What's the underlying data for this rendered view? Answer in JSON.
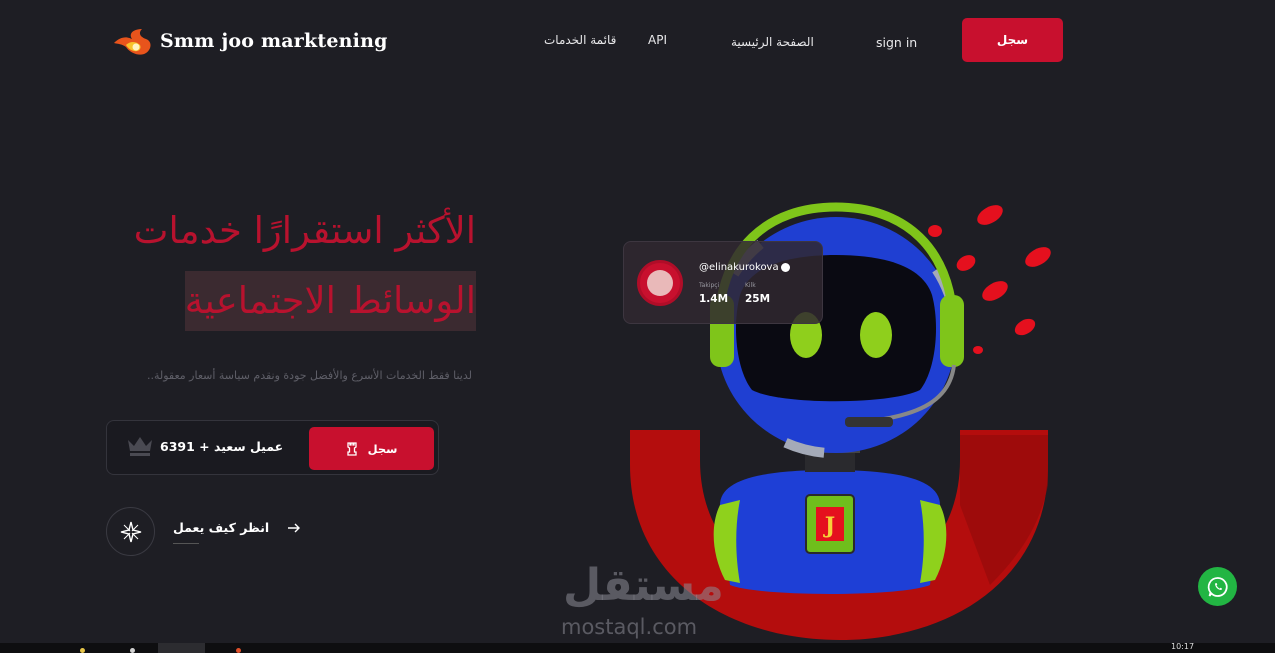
{
  "header": {
    "logo_text": "Smm joo marktening",
    "nav": {
      "services": "قائمة الخدمات",
      "api": "API",
      "home": "الصفحة الرئيسية",
      "signin": "sign in"
    },
    "register_button": "سجل"
  },
  "hero": {
    "title_line1": "الأكثر استقرارًا خدمات",
    "title_line2": "الوسائط الاجتماعية",
    "subtitle": "لدينا فقط الخدمات الأسرع والأفضل جودة ونقدم سياسة أسعار معقولة..",
    "happy_clients": "عميل سعيد + 6391",
    "register_button": "سجل",
    "how_it_works": "انظر كيف يعمل"
  },
  "profile_card": {
    "handle": "@elinakurokova",
    "followers_label": "Takipçi",
    "followers_value": "1.4M",
    "likes_label": "Kilk",
    "likes_value": "25M"
  },
  "watermark": {
    "arabic": "مستقل",
    "latin": "mostaql.com"
  },
  "taskbar": {
    "clock": "10:17"
  },
  "colors": {
    "background": "#1e1e24",
    "accent": "#c8102e",
    "whatsapp": "#22b543"
  },
  "icons": {
    "logo": "flame-logo-icon",
    "crown": "crown-icon",
    "rook": "rook-icon",
    "star": "compass-star-icon",
    "arrow": "arrow-right-icon",
    "whatsapp": "whatsapp-icon"
  }
}
